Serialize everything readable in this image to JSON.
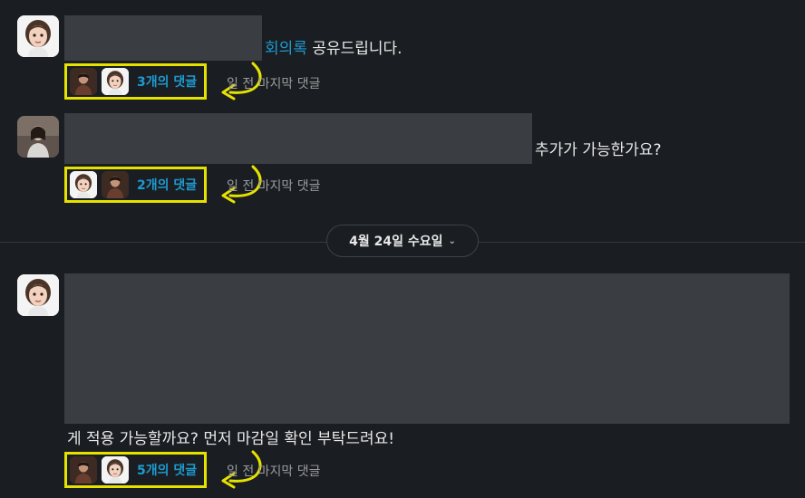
{
  "messages": [
    {
      "text_link": "회의록",
      "text": " 공유드립니다.",
      "thread": {
        "reply_count": "3개의 댓글",
        "last_reply": "일 전 마지막 댓글"
      }
    },
    {
      "text": "추가가 가능한가요?",
      "thread": {
        "reply_count": "2개의 댓글",
        "last_reply": "일 전 마지막 댓글"
      }
    },
    {
      "text": "게 적용 가능할까요? 먼저 마감일 확인 부탁드려요!",
      "thread": {
        "reply_count": "5개의 댓글",
        "last_reply": "일 전 마지막 댓글"
      }
    }
  ],
  "date_divider": {
    "label": "4월 24일 수요일"
  },
  "colors": {
    "background": "#1a1d21",
    "link": "#1d9bd1",
    "highlight": "#e6e200",
    "redaction": "#3a3d41"
  }
}
